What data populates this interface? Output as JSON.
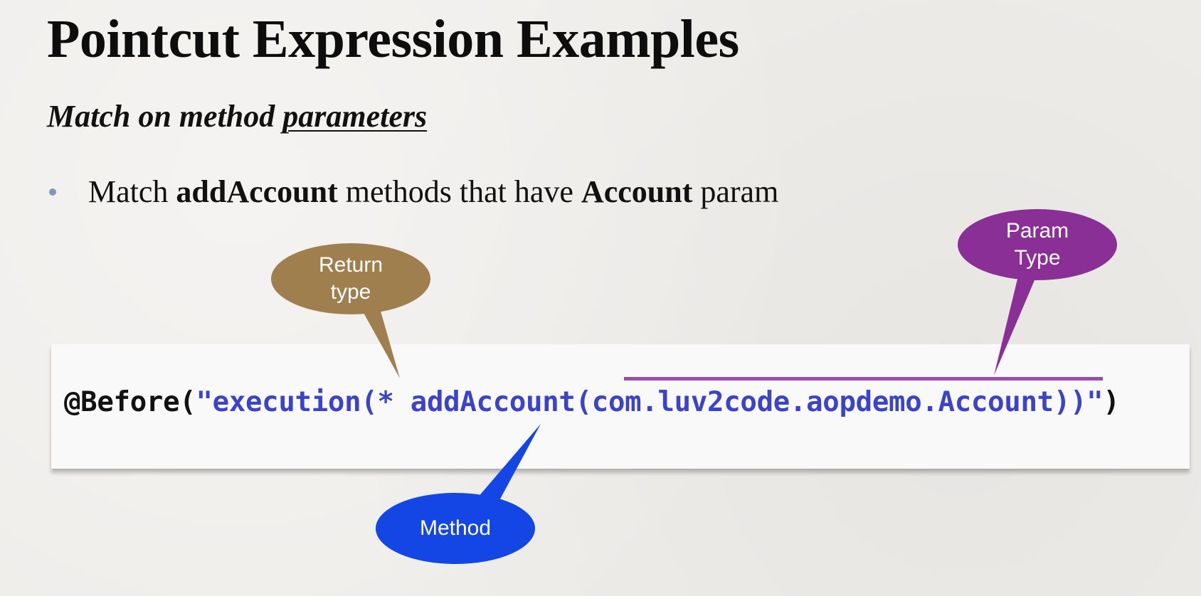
{
  "slide": {
    "title": "Pointcut Expression Examples",
    "subtitle_prefix": "Match on method ",
    "subtitle_emphasis": "parameters",
    "bullet": {
      "part1": "Match ",
      "bold1": "addAccount",
      "part2": " methods that have ",
      "bold2": "Account",
      "part3": " param"
    }
  },
  "code": {
    "annotation": "@Before(",
    "expression": "\"execution(* addAccount(com.luv2code.aopdemo.Account))\"",
    "close": ")"
  },
  "callouts": {
    "return_type": {
      "line1": "Return",
      "line2": "type",
      "color": "#a07f4f"
    },
    "param_type": {
      "line1": "Param",
      "line2": "Type",
      "color": "#8a2f96"
    },
    "method": {
      "label": "Method",
      "color": "#1446e6"
    }
  }
}
